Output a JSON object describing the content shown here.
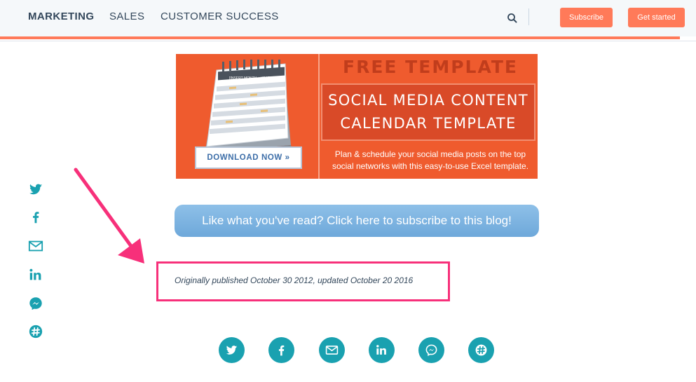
{
  "header": {
    "nav": [
      "MARKETING",
      "SALES",
      "CUSTOMER SUCCESS"
    ],
    "search_icon": "search-icon",
    "subscribe_label": "Subscribe",
    "get_started_label": "Get started"
  },
  "banner": {
    "headline": "FREE TEMPLATE",
    "title_line1": "SOCIAL MEDIA CONTENT",
    "title_line2": "CALENDAR TEMPLATE",
    "description": "Plan & schedule your social media posts on the top social networks with this easy-to-use Excel template.",
    "calendar_label": "[INSERT MONTH + YEAR]",
    "download_label": "DOWNLOAD NOW »"
  },
  "cta": {
    "label": "Like what you've read? Click here to subscribe to this blog!"
  },
  "article": {
    "published": "Originally published October 30 2012, updated October 20 2016"
  },
  "share": {
    "side_icons": [
      "twitter-icon",
      "facebook-icon",
      "email-icon",
      "linkedin-icon",
      "messenger-icon",
      "slack-icon"
    ],
    "bottom_icons": [
      "twitter-icon",
      "facebook-icon",
      "email-icon",
      "linkedin-icon",
      "messenger-icon",
      "slack-icon"
    ]
  },
  "colors": {
    "accent": "#ff7a59",
    "banner": "#ef5b2e",
    "social": "#1aa1b0",
    "highlight": "#f7307a",
    "cta": "#7db4e0"
  }
}
